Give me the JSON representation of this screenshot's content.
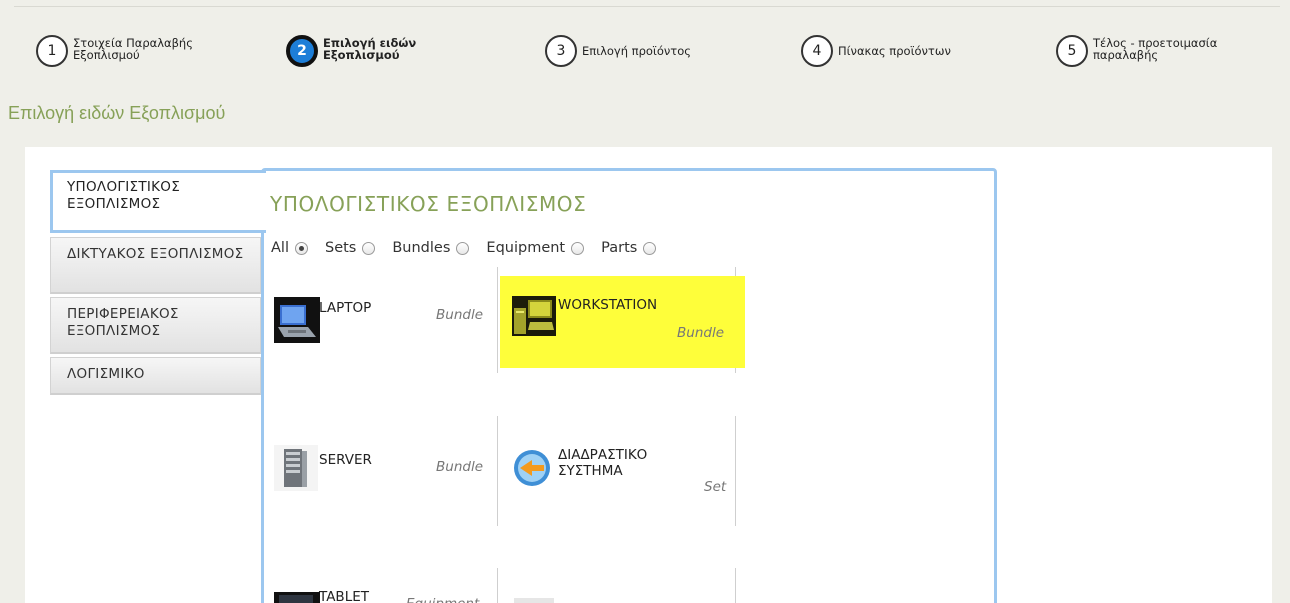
{
  "steps": [
    {
      "num": "1",
      "label": "Στοιχεία Παραλαβής Εξοπλισμού"
    },
    {
      "num": "2",
      "label": "Επιλογή ειδών Εξοπλισμού"
    },
    {
      "num": "3",
      "label": "Επιλογή προϊόντος"
    },
    {
      "num": "4",
      "label": "Πίνακας προϊόντων"
    },
    {
      "num": "5",
      "label": "Τέλος - προετοιμασία παραλαβής"
    }
  ],
  "page_title": "Επιλογή ειδών Εξοπλισμού",
  "categories": [
    {
      "label": "ΥΠΟΛΟΓΙΣΤΙΚΟΣ ΕΞΟΠΛΙΣΜΟΣ"
    },
    {
      "label": "ΔΙΚΤΥΑΚΟΣ ΕΞΟΠΛΙΣΜΟΣ"
    },
    {
      "label": "ΠΕΡΙΦΕΡΕΙΑΚΟΣ ΕΞΟΠΛΙΣΜΟΣ"
    },
    {
      "label": "ΛΟΓΙΣΜΙΚΟ"
    }
  ],
  "panel_heading": "ΥΠΟΛΟΓΙΣΤΙΚΟΣ ΕΞΟΠΛΙΣΜΟΣ",
  "filters": [
    {
      "label": "All",
      "checked": true
    },
    {
      "label": "Sets",
      "checked": false
    },
    {
      "label": "Bundles",
      "checked": false
    },
    {
      "label": "Equipment",
      "checked": false
    },
    {
      "label": "Parts",
      "checked": false
    }
  ],
  "items": [
    {
      "name": "LAPTOP",
      "kind": "Bundle",
      "icon": "laptop-icon"
    },
    {
      "name": "WORKSTATION",
      "kind": "Bundle",
      "icon": "workstation-icon",
      "highlighted": true
    },
    {
      "name": "SERVER",
      "kind": "Bundle",
      "icon": "server-icon"
    },
    {
      "name": "ΔΙΑΔΡΑΣΤΙΚΟ ΣΥΣΤΗΜΑ",
      "kind": "Set",
      "icon": "interactive-system-icon"
    },
    {
      "name": "TABLET",
      "kind": "Equipment",
      "icon": "tablet-icon"
    }
  ],
  "colors": {
    "accent_green": "#87a158",
    "panel_border": "#9cc7ef",
    "active_step": "#1d7ed8",
    "highlight": "#fefe3a"
  }
}
